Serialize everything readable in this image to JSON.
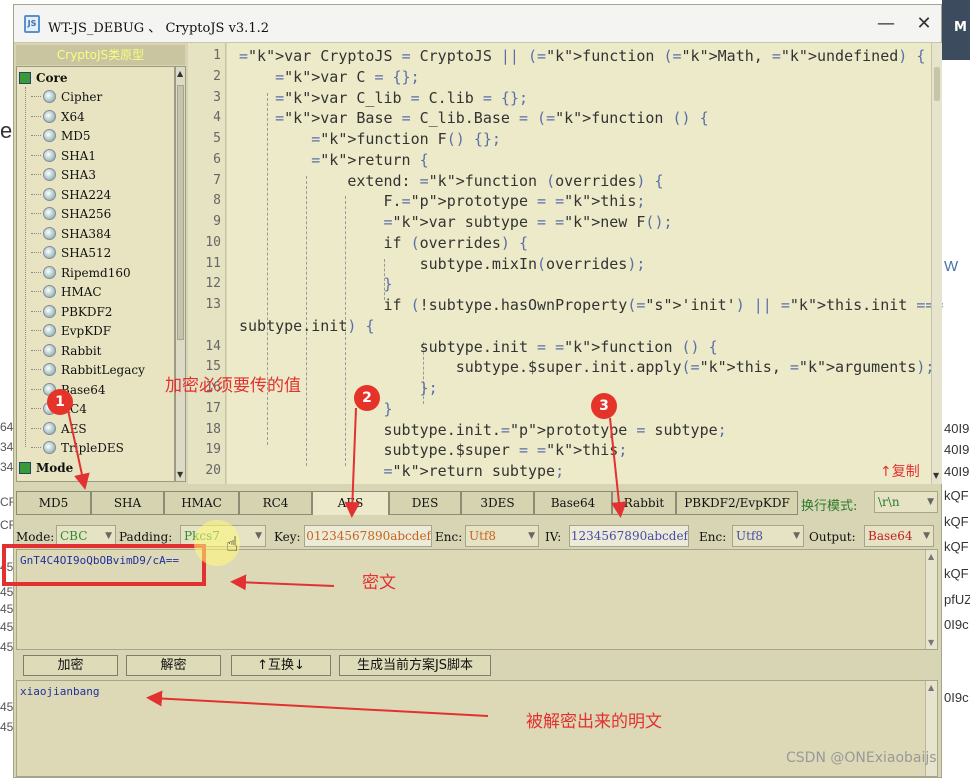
{
  "window": {
    "title": "WT-JS_DEBUG 、 CryptoJS v3.1.2",
    "minimize": "—",
    "close": "✕"
  },
  "tree": {
    "header": "CryptoJS类原型",
    "groups": [
      {
        "label": "Core",
        "items": [
          "Cipher",
          "X64",
          "MD5",
          "SHA1",
          "SHA3",
          "SHA224",
          "SHA256",
          "SHA384",
          "SHA512",
          "Ripemd160",
          "HMAC",
          "PBKDF2",
          "EvpKDF",
          "Rabbit",
          "RabbitLegacy",
          "Base64",
          "RC4",
          "AES",
          "TripleDES"
        ]
      },
      {
        "label": "Mode",
        "items": [
          "..."
        ]
      }
    ]
  },
  "editor": {
    "line_numbers": [
      "1",
      "2",
      "3",
      "4",
      "5",
      "6",
      "7",
      "8",
      "9",
      "10",
      "11",
      "12",
      "13",
      "",
      "14",
      "15",
      "16",
      "17",
      "18",
      "19",
      "20"
    ],
    "lines": [
      "var CryptoJS = CryptoJS || (function (Math, undefined) {",
      "    var C = {};",
      "    var C_lib = C.lib = {};",
      "    var Base = C_lib.Base = (function () {",
      "        function F() {};",
      "        return {",
      "            extend: function (overrides) {",
      "                F.prototype = this;",
      "                var subtype = new F();",
      "                if (overrides) {",
      "                    subtype.mixIn(overrides);",
      "                }",
      "                if (!subtype.hasOwnProperty('init') || this.init ===",
      "subtype.init) {",
      "                    subtype.init = function () {",
      "                        subtype.$super.init.apply(this, arguments);",
      "                    };",
      "                }",
      "                subtype.init.prototype = subtype;",
      "                subtype.$super = this;",
      "                return subtype;"
    ],
    "copy_label": "↑复制"
  },
  "tabs": [
    "MD5",
    "SHA",
    "HMAC",
    "RC4",
    "AES",
    "DES",
    "3DES",
    "Base64",
    "Rabbit",
    "PBKDF2/EvpKDF"
  ],
  "active_tab": "AES",
  "line_mode": {
    "label": "换行模式:",
    "value": "\\r\\n"
  },
  "params": {
    "mode_label": "Mode:",
    "mode": "CBC",
    "padding_label": "Padding:",
    "padding": "Pkcs7",
    "key_label": "Key:",
    "key": "01234567890abcdef",
    "enc1_label": "Enc:",
    "enc1": "Utf8",
    "iv_label": "IV:",
    "iv": "1234567890abcdef",
    "enc2_label": "Enc:",
    "enc2": "Utf8",
    "output_label": "Output:",
    "output": "Base64"
  },
  "ciphertext": "GnT4C4OI9oQbOBvimD9/cA==",
  "buttons": {
    "encrypt": "加密",
    "decrypt": "解密",
    "swap": "↑互换↓",
    "generate": "生成当前方案JS脚本"
  },
  "plaintext": "xiaojianbang",
  "annotations": {
    "badge1": "1",
    "badge2": "2",
    "badge3": "3",
    "required_values": "加密必须要传的值",
    "ciphertext_label": "密文",
    "plaintext_label": "被解密出来的明文"
  },
  "watermark": "CSDN @ONExiaobaijs",
  "background": {
    "header": "M",
    "left_letter": "e",
    "right_snippets": [
      "W",
      "40I9",
      "40I9",
      "40I9",
      "kQF",
      "kQF",
      "kQF",
      "kQF",
      "pfUZ",
      "0I9c",
      "0I9c"
    ],
    "left_snippets": [
      "64",
      "34",
      "34",
      "CF",
      "CF",
      "45",
      "45",
      "45",
      "45",
      "45",
      "45",
      "45"
    ]
  },
  "colors": {
    "window_bg": "#d8d5b4",
    "annotation_red": "#e23131",
    "keyword": "#7a3c9c"
  }
}
